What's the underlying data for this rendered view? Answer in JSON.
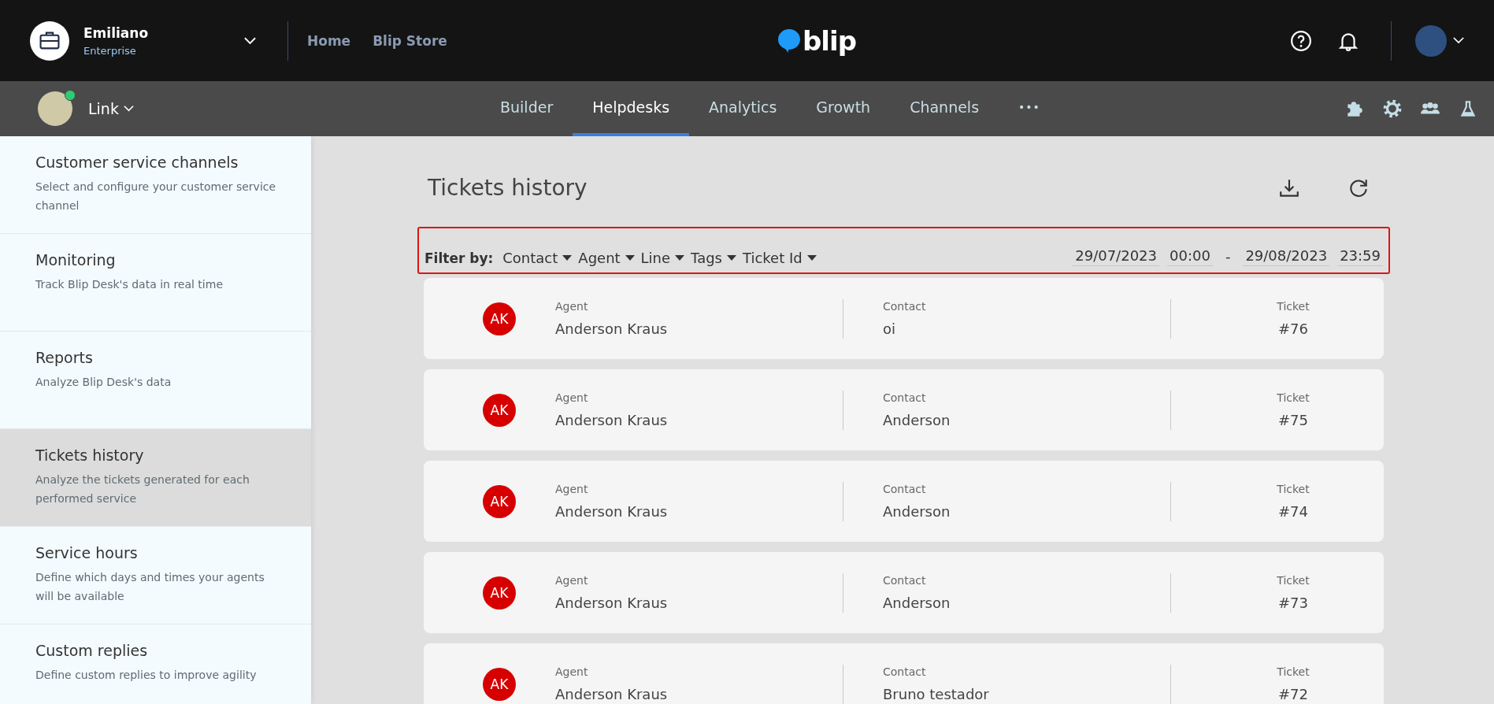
{
  "account": {
    "name": "Emiliano",
    "plan": "Enterprise"
  },
  "top_links": [
    "Home",
    "Blip Store"
  ],
  "logo": "blip",
  "bot": {
    "name": "Link",
    "online": true
  },
  "tabs": [
    {
      "label": "Builder",
      "selected": false
    },
    {
      "label": "Helpdesks",
      "selected": true
    },
    {
      "label": "Analytics",
      "selected": false
    },
    {
      "label": "Growth",
      "selected": false
    },
    {
      "label": "Channels",
      "selected": false
    }
  ],
  "more_tabs": "•••",
  "sidebar": {
    "items": [
      {
        "title": "Customer service channels",
        "description": "Select and configure your customer service channel",
        "selected": false
      },
      {
        "title": "Monitoring",
        "description": "Track Blip Desk's data in real time",
        "selected": false
      },
      {
        "title": "Reports",
        "description": "Analyze Blip Desk's data",
        "selected": false
      },
      {
        "title": "Tickets history",
        "description": "Analyze the tickets generated for each performed service",
        "selected": true
      },
      {
        "title": "Service hours",
        "description": "Define which days and times your agents will be available",
        "selected": false
      },
      {
        "title": "Custom replies",
        "description": "Define custom replies to improve agility",
        "selected": false
      }
    ]
  },
  "page_title": "Tickets history",
  "filter": {
    "label": "Filter by:",
    "options": [
      "Contact",
      "Agent",
      "Line",
      "Tags",
      "Ticket Id"
    ],
    "start_date": "29/07/2023",
    "start_time": "00:00",
    "separator": "-",
    "end_date": "29/08/2023",
    "end_time": "23:59"
  },
  "tickets": [
    {
      "initials": "AK",
      "agent_label": "Agent",
      "agent": "Anderson Kraus",
      "contact_label": "Contact",
      "contact": "oi",
      "ticket_label": "Ticket",
      "ticket": "#76"
    },
    {
      "initials": "AK",
      "agent_label": "Agent",
      "agent": "Anderson Kraus",
      "contact_label": "Contact",
      "contact": "Anderson",
      "ticket_label": "Ticket",
      "ticket": "#75"
    },
    {
      "initials": "AK",
      "agent_label": "Agent",
      "agent": "Anderson Kraus",
      "contact_label": "Contact",
      "contact": "Anderson",
      "ticket_label": "Ticket",
      "ticket": "#74"
    },
    {
      "initials": "AK",
      "agent_label": "Agent",
      "agent": "Anderson Kraus",
      "contact_label": "Contact",
      "contact": "Anderson",
      "ticket_label": "Ticket",
      "ticket": "#73"
    },
    {
      "initials": "AK",
      "agent_label": "Agent",
      "agent": "Anderson Kraus",
      "contact_label": "Contact",
      "contact": "Bruno testador",
      "ticket_label": "Ticket",
      "ticket": "#72"
    }
  ]
}
